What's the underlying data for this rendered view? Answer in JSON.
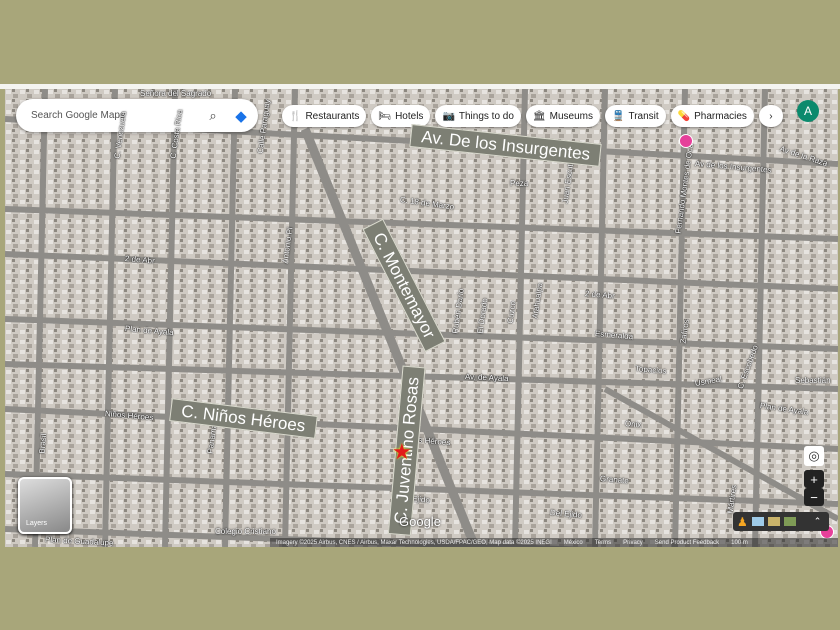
{
  "search": {
    "placeholder": "Search Google Maps"
  },
  "chips": [
    "Restaurants",
    "Hotels",
    "Things to do",
    "Museums",
    "Transit",
    "Pharmacies"
  ],
  "chip_icons": [
    "🍴",
    "🛏",
    "📷",
    "🏛",
    "🚆",
    "💊"
  ],
  "avatar": "A",
  "annotations": {
    "insurgentes": "Av. De los Insurgentes",
    "montemayor": "C. Montemayor",
    "ninos_heroes": "C. Niños Héroes",
    "juventino": "C. Juventino Rosas"
  },
  "streets": [
    "Av de los Insurgentes",
    "Av de la Raza",
    "C. 18 de Marzo",
    "2 de Abr",
    "2 de Abr",
    "Plan de Ayala",
    "Plan de Ayala",
    "Av. de Ayala",
    "Esmeralda",
    "Topacios",
    "Niños Héroes",
    "Niños Héroes",
    "Onix",
    "Granate",
    "Del Ejido",
    "Del Ejido",
    "Plan de Guadalupe",
    "Colegio Cristiano",
    "Señora del Sagrado",
    "Calle Paraguay",
    "C. Venezuela",
    "C. Costa Rica",
    "Panamá",
    "Antonio Pl",
    "Fernando Montes de Oca",
    "Juan Escutia",
    "Rubén Darío",
    "El Dorado",
    "Cuzco",
    "Atahualpa",
    "Zafiros",
    "Sebastián",
    "Usmeal",
    "C. Escobedo",
    "Mártires",
    "Brasil",
    "Peza"
  ],
  "layers_label": "Layers",
  "google": "Google",
  "attribution": [
    "Imagery ©2025 Airbus, CNES / Airbus, Maxar Technologies, USDA/FPAC/GEO, Map data ©2025 INEGI",
    "México",
    "Terms",
    "Privacy",
    "Send Product Feedback",
    "100 m"
  ],
  "zoom": {
    "in": "+",
    "out": "−"
  }
}
